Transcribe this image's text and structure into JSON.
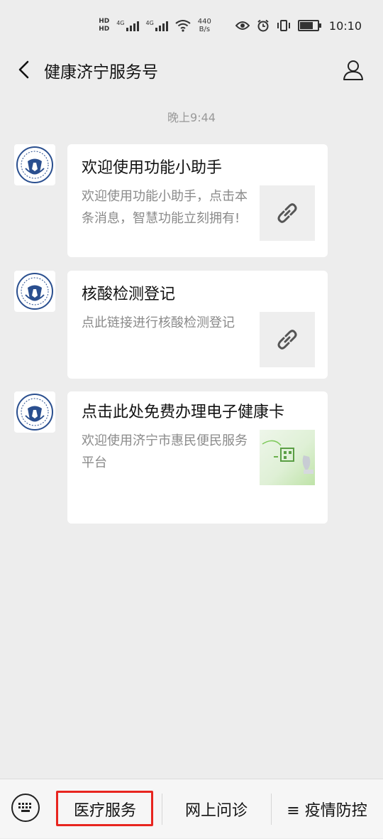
{
  "status_bar": {
    "hd1": "HD",
    "hd2": "HD",
    "sig1": "4G",
    "sig2": "4G",
    "net_speed_value": "440",
    "net_speed_unit": "B/s",
    "time": "10:10",
    "icons": [
      "eye-icon",
      "alarm-icon",
      "vibrate-icon",
      "battery-icon"
    ]
  },
  "header": {
    "title": "健康济宁服务号",
    "back_icon": "chevron-left-icon",
    "profile_icon": "person-icon"
  },
  "timestamp": "晚上9:44",
  "messages": [
    {
      "title": "欢迎使用功能小助手",
      "desc": "欢迎使用功能小助手，点击本条消息，智慧功能立刻拥有!",
      "thumb": "link-icon"
    },
    {
      "title": "核酸检测登记",
      "desc": "点此链接进行核酸检测登记",
      "thumb": "link-icon"
    },
    {
      "title": "点击此处免费办理电子健康卡",
      "desc": "欢迎使用济宁市惠民便民服务平台",
      "thumb": "image"
    }
  ],
  "bottom_menu": {
    "keyboard_icon": "keyboard-icon",
    "items": [
      "医疗服务",
      "网上问诊",
      "≡ 疫情防控"
    ],
    "highlight_color": "#e8251f"
  }
}
